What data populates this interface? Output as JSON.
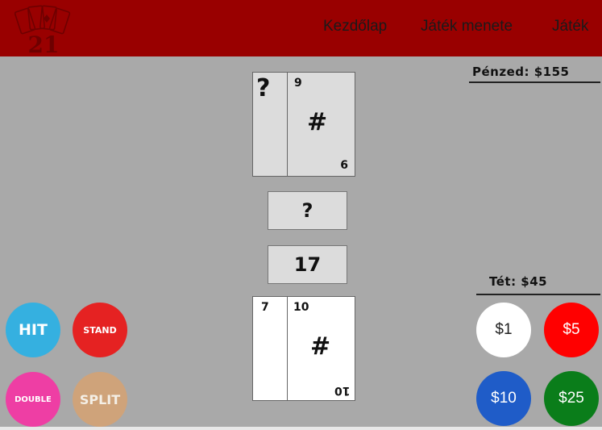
{
  "header": {
    "logo_text": "21",
    "nav": [
      "Kezdőlap",
      "Játék menete",
      "Játék"
    ]
  },
  "money": {
    "label": "Pénzed: $155"
  },
  "bet": {
    "label": "Tét: $45"
  },
  "dealer": {
    "hidden_card_symbol": "?",
    "visible_card": {
      "top_value": "9",
      "bottom_value": "6",
      "center": "#"
    },
    "score": "?"
  },
  "player": {
    "score": "17",
    "back_card_value": "7",
    "front_card": {
      "top_value": "10",
      "bottom_value": "10",
      "center": "#"
    }
  },
  "actions": {
    "hit": "HIT",
    "stand": "STAND",
    "double": "DOUBLE",
    "split": "SPLIT"
  },
  "chips": [
    "$1",
    "$5",
    "$10",
    "$25"
  ],
  "colors": {
    "header": "#990000",
    "background": "#a9a9a9",
    "hit": "#35b0e0",
    "stand": "#e52222",
    "double": "#ee3ea4",
    "split": "#cfa37a",
    "chip_1": "#ffffff",
    "chip_5": "#ff0000",
    "chip_10": "#1f5cc8",
    "chip_25": "#0a7d1a"
  }
}
